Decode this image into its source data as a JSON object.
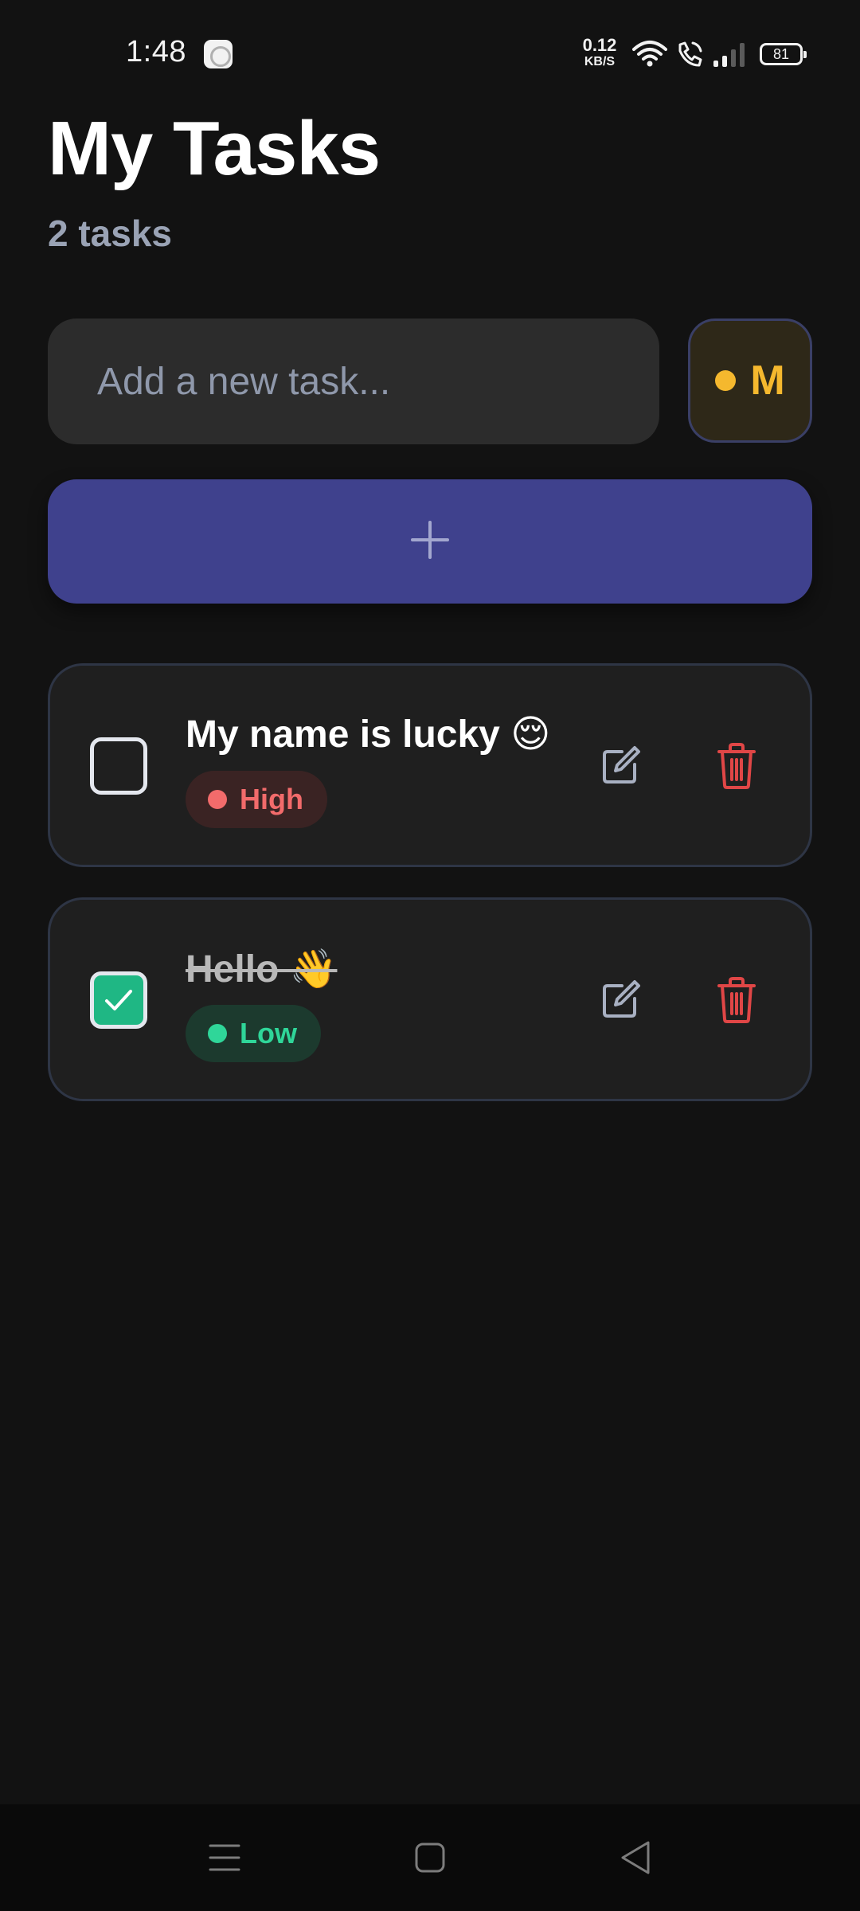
{
  "status_bar": {
    "time": "1:48",
    "net_speed_value": "0.12",
    "net_speed_unit": "KB/S",
    "battery": "81"
  },
  "header": {
    "title": "My Tasks",
    "count": "2 tasks"
  },
  "composer": {
    "placeholder": "Add a new task...",
    "priority_letter": "M",
    "priority_color": "#f5b82e",
    "add_icon": "plus-icon"
  },
  "tasks": [
    {
      "title": "My name is lucky 😌",
      "completed": false,
      "priority": "High",
      "priority_color": "#f26b6b"
    },
    {
      "title": "Hello 👋",
      "completed": true,
      "priority": "Low",
      "priority_color": "#2fd699"
    }
  ],
  "nav": {
    "icons": [
      "menu-icon",
      "home-icon",
      "back-icon"
    ]
  },
  "colors": {
    "background": "#121212",
    "accent": "#3f418d",
    "danger": "#e04646",
    "success": "#1fb784"
  }
}
